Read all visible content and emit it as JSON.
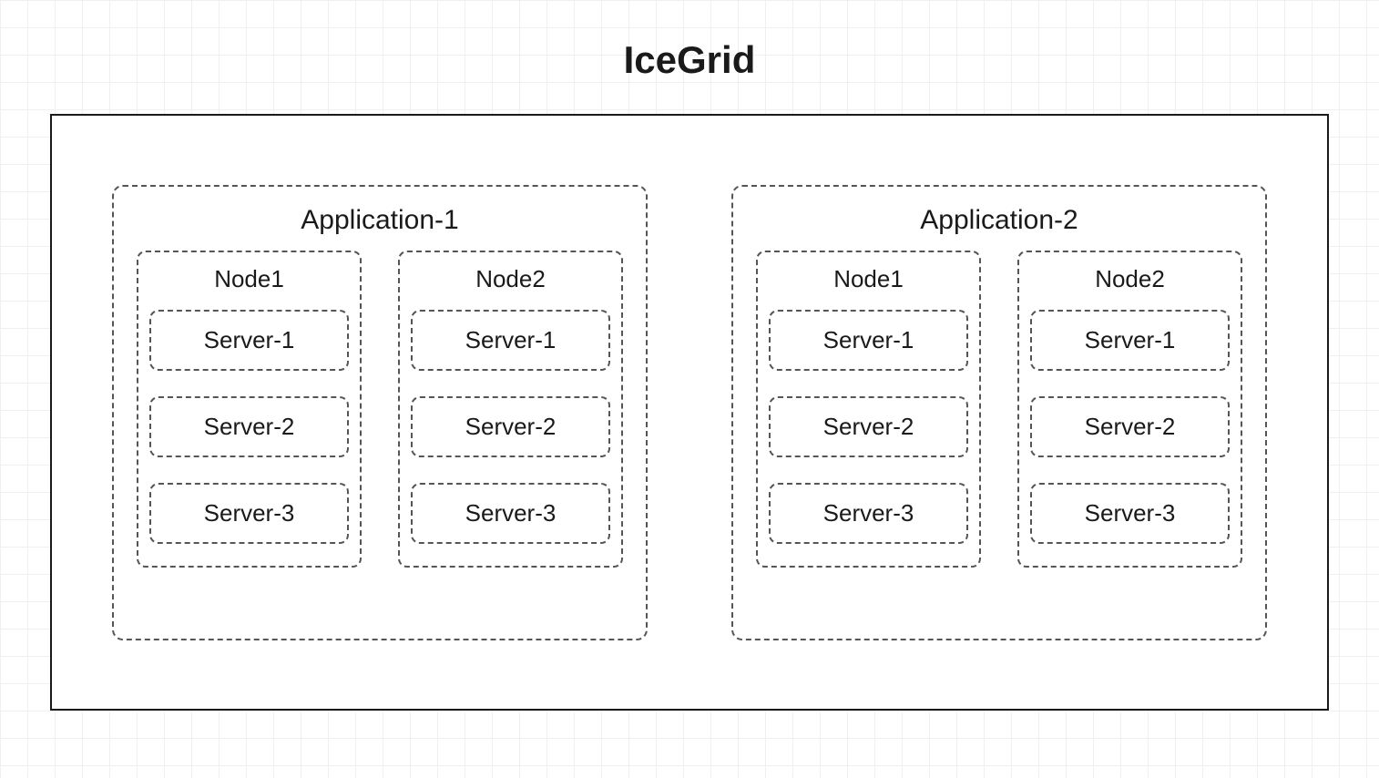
{
  "title": "IceGrid",
  "applications": [
    {
      "name": "Application-1",
      "nodes": [
        {
          "name": "Node1",
          "servers": [
            "Server-1",
            "Server-2",
            "Server-3"
          ]
        },
        {
          "name": "Node2",
          "servers": [
            "Server-1",
            "Server-2",
            "Server-3"
          ]
        }
      ]
    },
    {
      "name": "Application-2",
      "nodes": [
        {
          "name": "Node1",
          "servers": [
            "Server-1",
            "Server-2",
            "Server-3"
          ]
        },
        {
          "name": "Node2",
          "servers": [
            "Server-1",
            "Server-2",
            "Server-3"
          ]
        }
      ]
    }
  ]
}
